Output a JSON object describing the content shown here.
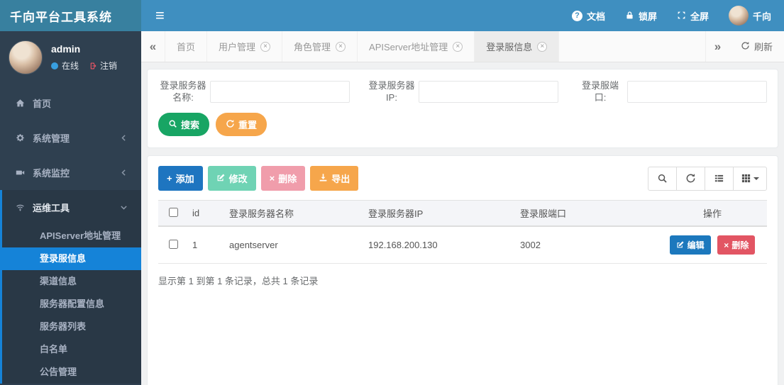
{
  "app": {
    "title": "千向平台工具系统"
  },
  "icons": {
    "hamburger": "≡",
    "question": "?",
    "prev": "«",
    "next": "»",
    "close": "×",
    "plus": "+",
    "times": "×"
  },
  "header": {
    "doc": "文档",
    "lock": "锁屏",
    "fullscreen": "全屏",
    "user": "千向"
  },
  "sidebar": {
    "user": {
      "name": "admin",
      "status": "在线",
      "logout": "注销"
    },
    "items": [
      {
        "label": "首页"
      },
      {
        "label": "系统管理"
      },
      {
        "label": "系统监控"
      },
      {
        "label": "运维工具"
      }
    ],
    "submenu": [
      {
        "label": "APIServer地址管理"
      },
      {
        "label": "登录服信息"
      },
      {
        "label": "渠道信息"
      },
      {
        "label": "服务器配置信息"
      },
      {
        "label": "服务器列表"
      },
      {
        "label": "白名单"
      },
      {
        "label": "公告管理"
      }
    ],
    "active_submenu": "登录服信息"
  },
  "tabs": {
    "items": [
      {
        "label": "首页"
      },
      {
        "label": "用户管理"
      },
      {
        "label": "角色管理"
      },
      {
        "label": "APIServer地址管理"
      },
      {
        "label": "登录服信息"
      }
    ],
    "active": "登录服信息",
    "refresh": "刷新"
  },
  "filters": {
    "fields": [
      {
        "line1": "登录服务器",
        "line2": "名称:",
        "value": ""
      },
      {
        "line1": "登录服务器",
        "line2": "IP:",
        "value": ""
      },
      {
        "line1": "登录服端",
        "line2": "口:",
        "value": ""
      }
    ],
    "search": "搜索",
    "reset": "重置"
  },
  "toolbar": {
    "add": "添加",
    "modify": "修改",
    "remove": "删除",
    "export": "导出"
  },
  "table": {
    "headers": [
      "id",
      "登录服务器名称",
      "登录服务器IP",
      "登录服端口",
      "操作"
    ],
    "rows": [
      {
        "id": "1",
        "name": "agentserver",
        "ip": "192.168.200.130",
        "port": "3002",
        "edit": "编辑",
        "del": "删除"
      }
    ],
    "summary": "显示第 1 到第 1 条记录，总共 1 条记录"
  },
  "colors": {
    "header": "#3f8fc0",
    "logo": "#38809f",
    "sidebar": "#2f4050",
    "submenu_bg": "#293846",
    "active_blue": "#1583d8",
    "primary": "#1e75c0",
    "success": "#18a564",
    "warning": "#f6a64b",
    "danger": "#e25563",
    "disabled_teal": "#6fd3b4",
    "disabled_pink": "#f09dab"
  }
}
